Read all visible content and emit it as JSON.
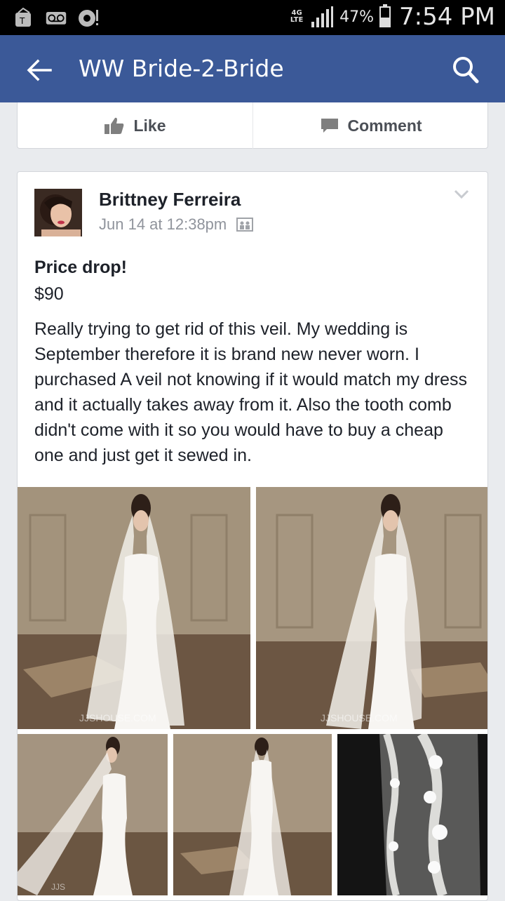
{
  "status_bar": {
    "network": "4G LTE",
    "battery": "47%",
    "battery_level": 0.47,
    "time": "7:54 PM"
  },
  "app_bar": {
    "title": "WW Bride-2-Bride",
    "back_icon": "arrow-left-icon",
    "search_icon": "search-icon",
    "color": "#3b5998"
  },
  "actions": {
    "like_label": "Like",
    "comment_label": "Comment"
  },
  "post": {
    "author": "Brittney Ferreira",
    "timestamp": "Jun 14 at 12:38pm",
    "title": "Price drop!",
    "price": "$90",
    "body": "Really trying to get rid of this veil. My wedding is September therefore it is brand new never worn. I purchased A veil not knowing if it would match my dress and it actually takes away from it. Also the tooth comb didn't come with it so you would have to buy a cheap one and just get it sewed in.",
    "photos": [
      {
        "watermark": "JJSHOUSE.COM"
      },
      {
        "watermark": "JJSHOUSE.COM"
      },
      {
        "watermark": "JJS"
      },
      {
        "watermark": ""
      },
      {
        "watermark": ""
      }
    ]
  }
}
